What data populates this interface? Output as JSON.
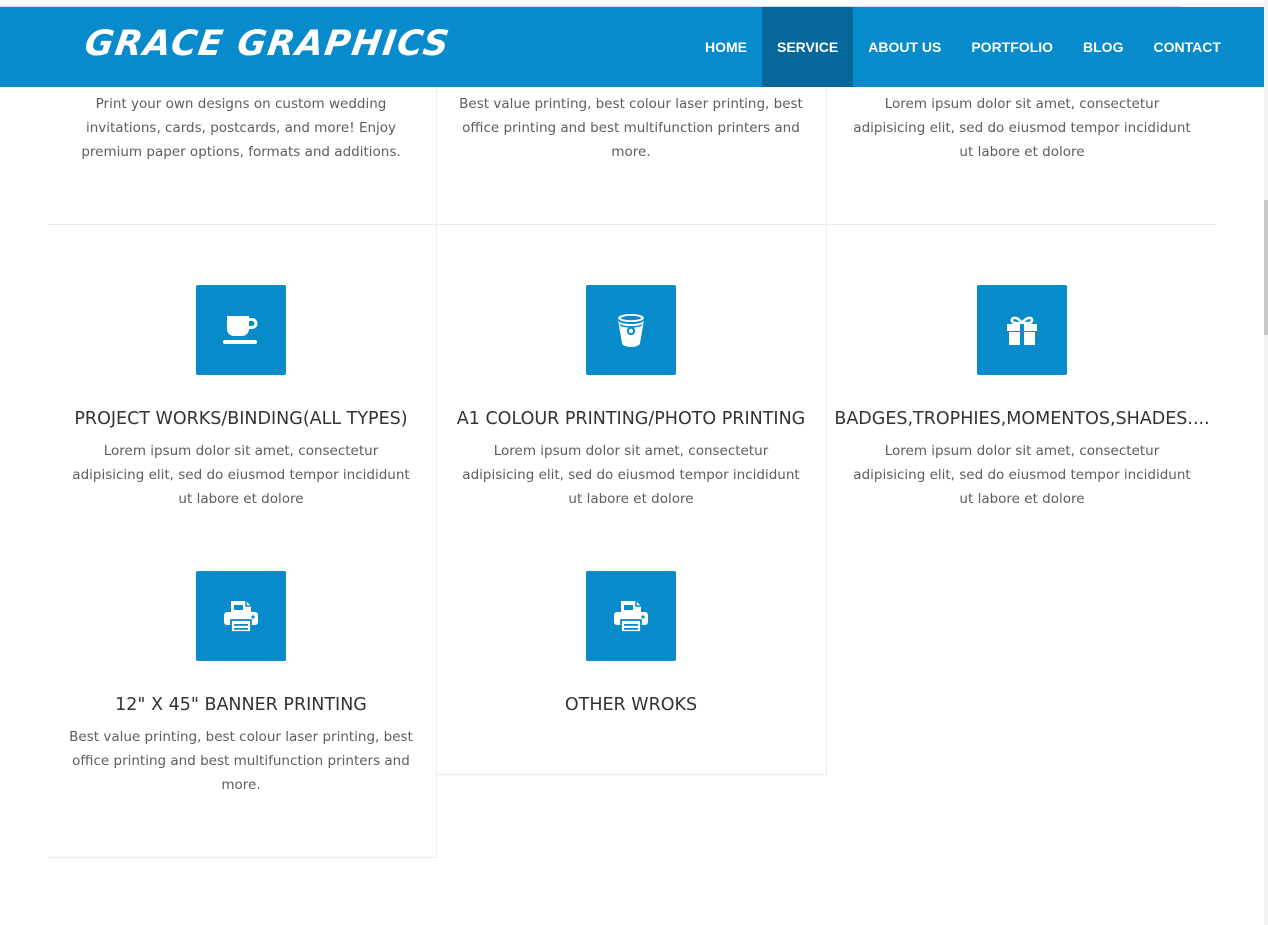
{
  "brand": {
    "logo": "GRACE GRAPHICS",
    "accent_color": "#078bcb",
    "active_color": "#06679a"
  },
  "nav": {
    "items": [
      {
        "label": "HOME"
      },
      {
        "label": "SERVICE"
      },
      {
        "label": "ABOUT US"
      },
      {
        "label": "PORTFOLIO"
      },
      {
        "label": "BLOG"
      },
      {
        "label": "CONTACT"
      }
    ],
    "active": "SERVICE"
  },
  "services_top": [
    {
      "description": "Print your own designs on custom wedding invitations, cards, postcards, and more! Enjoy premium paper options, formats and additions."
    },
    {
      "description": "Best value printing, best colour laser printing, best office printing and best multifunction printers and more."
    },
    {
      "description": "Lorem ipsum dolor sit amet, consectetur adipisicing elit, sed do eiusmod tempor incididunt ut labore et dolore"
    }
  ],
  "services": [
    {
      "icon": "coffee-cup-icon",
      "title": "PROJECT WORKS/BINDING(ALL TYPES)",
      "description": "Lorem ipsum dolor sit amet, consectetur adipisicing elit, sed do eiusmod tempor incididunt ut labore et dolore"
    },
    {
      "icon": "bucket-icon",
      "title": "A1 COLOUR PRINTING/PHOTO PRINTING",
      "description": "Lorem ipsum dolor sit amet, consectetur adipisicing elit, sed do eiusmod tempor incididunt ut labore et dolore"
    },
    {
      "icon": "gift-icon",
      "title": "BADGES,TROPHIES,MOMENTOS,SHADES....",
      "description": "Lorem ipsum dolor sit amet, consectetur adipisicing elit, sed do eiusmod tempor incididunt ut labore et dolore"
    },
    {
      "icon": "printer-icon",
      "title": "12\" X 45\" BANNER PRINTING",
      "description": "Best value printing, best colour laser printing, best office printing and best multifunction printers and more."
    },
    {
      "icon": "printer-icon",
      "title": "OTHER WROKS",
      "description": ""
    }
  ]
}
